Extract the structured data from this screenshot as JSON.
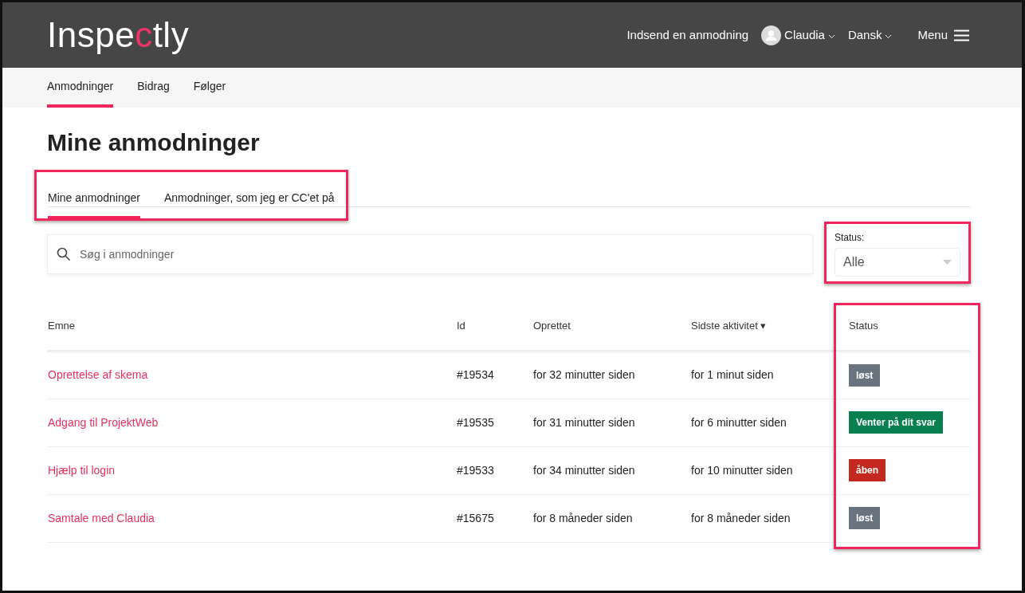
{
  "header": {
    "logo": {
      "before": "Inspe",
      "accent": "c",
      "after": "tly"
    },
    "submit_link": "Indsend en anmodning",
    "user": "Claudia",
    "language": "Dansk",
    "menu": "Menu"
  },
  "subnav": [
    {
      "label": "Anmodninger",
      "selected": true
    },
    {
      "label": "Bidrag",
      "selected": false
    },
    {
      "label": "Følger",
      "selected": false
    }
  ],
  "page_title": "Mine anmodninger",
  "tabs": [
    {
      "label": "Mine anmodninger",
      "selected": true
    },
    {
      "label": "Anmodninger, som jeg er CC'et på",
      "selected": false
    }
  ],
  "search": {
    "placeholder": "Søg i anmodninger"
  },
  "status_filter": {
    "label": "Status:",
    "value": "Alle"
  },
  "table": {
    "columns": [
      "Emne",
      "Id",
      "Oprettet",
      "Sidste aktivitet ▾",
      "Status"
    ],
    "rows": [
      {
        "subject": "Oprettelse af skema",
        "id": "#19534",
        "created": "for 32 minutter siden",
        "last_activity": "for 1 minut siden",
        "status": {
          "label": "løst",
          "color": "#68737d"
        }
      },
      {
        "subject": "Adgang til ProjektWeb",
        "id": "#19535",
        "created": "for 31 minutter siden",
        "last_activity": "for 6 minutter siden",
        "status": {
          "label": "Venter på dit svar",
          "color": "#087f4f"
        }
      },
      {
        "subject": "Hjælp til login",
        "id": "#19533",
        "created": "for 34 minutter siden",
        "last_activity": "for 10 minutter siden",
        "status": {
          "label": "åben",
          "color": "#c4271e"
        }
      },
      {
        "subject": "Samtale med Claudia",
        "id": "#15675",
        "created": "for 8 måneder siden",
        "last_activity": "for 8 måneder siden",
        "status": {
          "label": "løst",
          "color": "#68737d"
        }
      }
    ]
  }
}
